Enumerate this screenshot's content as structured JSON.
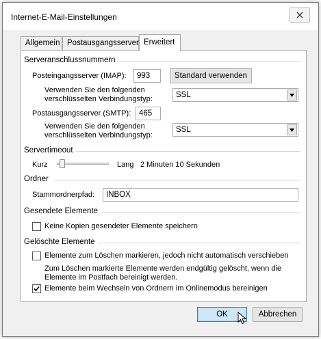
{
  "window": {
    "title": "Internet-E-Mail-Einstellungen",
    "close_glyph": "close-icon"
  },
  "tabs": [
    {
      "label": "Allgemein",
      "active": false
    },
    {
      "label": "Postausgangsserver",
      "active": false
    },
    {
      "label": "Erweitert",
      "active": true
    }
  ],
  "server_ports": {
    "group_title": "Serveranschlussnummern",
    "incoming_label": "Posteingangsserver (IMAP):",
    "incoming_port": "993",
    "default_button": "Standard verwenden",
    "incoming_encryption_label_line1": "Verwenden Sie den folgenden",
    "incoming_encryption_label_line2": "verschlüsselten Verbindungstyp:",
    "incoming_encryption_value": "SSL",
    "outgoing_label": "Postausgangsserver (SMTP):",
    "outgoing_port": "465",
    "outgoing_encryption_label_line1": "Verwenden Sie den folgenden",
    "outgoing_encryption_label_line2": "verschlüsselten Verbindungstyp:",
    "outgoing_encryption_value": "SSL"
  },
  "server_timeout": {
    "group_title": "Servertimeout",
    "short_label": "Kurz",
    "long_label": "Lang",
    "value_text": "2 Minuten 10 Sekunden",
    "slider_fraction": 0.1
  },
  "folders": {
    "group_title": "Ordner",
    "root_label": "Stammordnerpfad:",
    "root_value": "INBOX"
  },
  "sent_items": {
    "group_title": "Gesendete Elemente",
    "no_copies_label": "Keine Kopien gesendeter Elemente speichern",
    "no_copies_checked": false
  },
  "deleted_items": {
    "group_title": "Gelöschte Elemente",
    "mark_label": "Elemente zum Löschen markieren, jedoch nicht automatisch verschieben",
    "mark_checked": false,
    "info_line1": "Zum Löschen markierte Elemente werden endgültig gelöscht, wenn die",
    "info_line2": "Elemente im Postfach bereinigt werden.",
    "purge_label": "Elemente beim Wechseln von Ordnern im Onlinemodus bereinigen",
    "purge_checked": true
  },
  "footer": {
    "ok_label": "OK",
    "cancel_label": "Abbrechen"
  },
  "colors": {
    "window_bg": "#f0f0f0",
    "panel_bg": "#ffffff",
    "ok_accent": "#3c7fb1"
  }
}
